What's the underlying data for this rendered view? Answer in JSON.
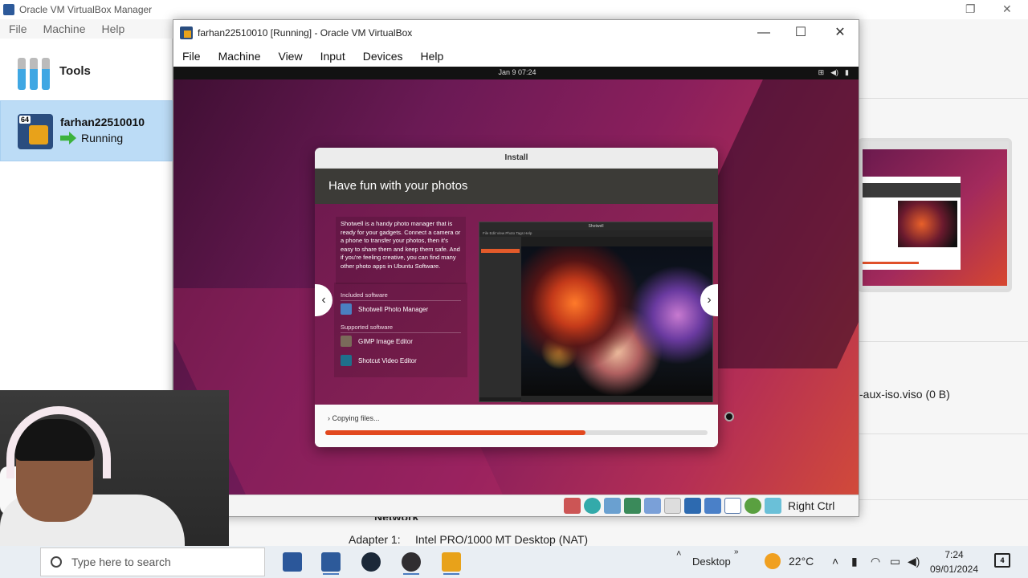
{
  "manager": {
    "title": "Oracle VM VirtualBox Manager",
    "menu": [
      "File",
      "Machine",
      "Help"
    ],
    "tools_label": "Tools",
    "vm": {
      "name": "farhan22510010",
      "state": "Running",
      "badge": "64"
    },
    "storage_text": "-aux-iso.viso (0 B)",
    "network_heading": "Network",
    "adapter_label": "Adapter 1:",
    "adapter_value": "Intel PRO/1000 MT Desktop (NAT)"
  },
  "vm_window": {
    "title": "farhan22510010 [Running] - Oracle VM VirtualBox",
    "menu": [
      "File",
      "Machine",
      "View",
      "Input",
      "Devices",
      "Help"
    ],
    "host_key": "Right Ctrl"
  },
  "guest": {
    "clock": "Jan 9  07:24",
    "installer": {
      "title": "Install",
      "heading": "Have fun with your photos",
      "description": "Shotwell is a handy photo manager that is ready for your gadgets. Connect a camera or a phone to transfer your photos, then it's easy to share them and keep them safe. And if you're feeling creative, you can find many other photo apps in Ubuntu Software.",
      "included_label": "Included software",
      "included": [
        {
          "name": "Shotwell Photo Manager",
          "icon": "shotwell-icon",
          "color": "#4a7fc0"
        }
      ],
      "supported_label": "Supported software",
      "supported": [
        {
          "name": "GIMP Image Editor",
          "icon": "gimp-icon",
          "color": "#7a6a5a"
        },
        {
          "name": "Shotcut Video Editor",
          "icon": "shotcut-icon",
          "color": "#1f6f8b"
        }
      ],
      "screenshot_title": "Shotwell",
      "screenshot_menu": "File  Edit  View  Photo  Tags  Help",
      "progress_label": "Copying files...",
      "progress": 0.68,
      "progress_color": "#e2481e"
    }
  },
  "taskbar": {
    "search_placeholder": "Type here to search",
    "apps": [
      {
        "name": "word",
        "color": "#2b579a"
      },
      {
        "name": "virtualbox",
        "color": "#2d5a9a"
      },
      {
        "name": "steam",
        "color": "#1b2838"
      },
      {
        "name": "obs",
        "color": "#302e31"
      },
      {
        "name": "virtualbox-vm",
        "color": "#e8a21a"
      }
    ],
    "desktop_label": "Desktop",
    "temperature": "22°C",
    "time": "7:24",
    "date": "09/01/2024",
    "notifications": "4"
  }
}
